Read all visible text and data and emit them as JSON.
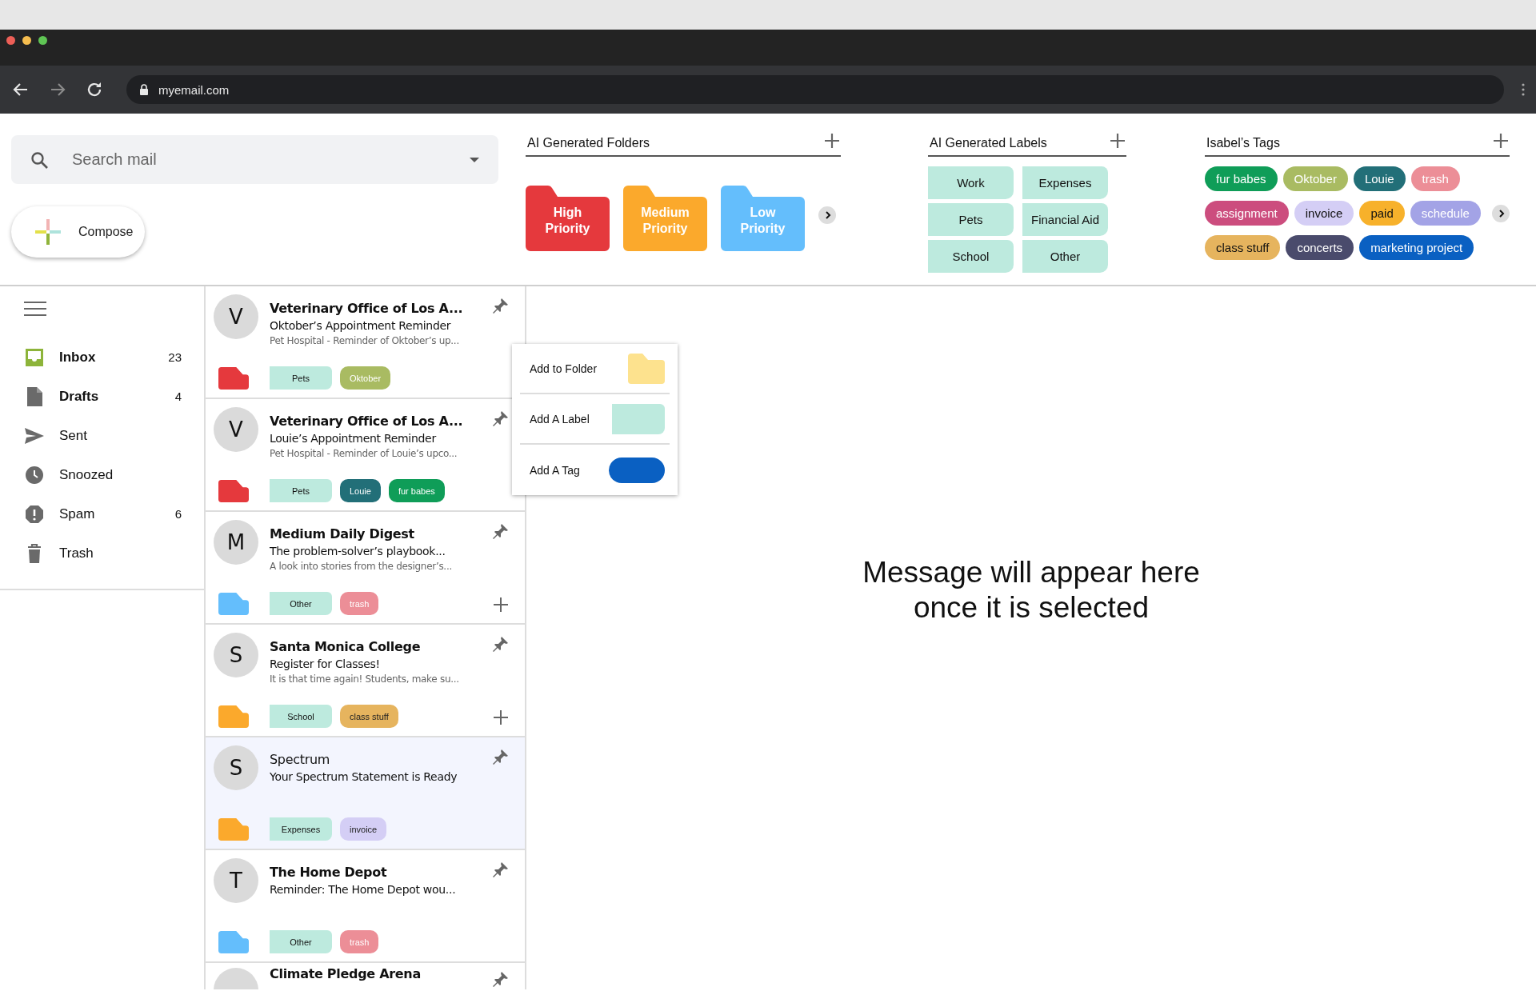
{
  "browser": {
    "url": "myemail.com"
  },
  "search": {
    "placeholder": "Search mail"
  },
  "compose": {
    "label": "Compose"
  },
  "folders_section": {
    "title": "AI Generated Folders",
    "folders": [
      {
        "label": "High Priority",
        "color": "#e5393d"
      },
      {
        "label": "Medium Priority",
        "color": "#fba92c"
      },
      {
        "label": "Low Priority",
        "color": "#64befc"
      }
    ]
  },
  "labels_section": {
    "title": "AI Generated Labels",
    "labels": [
      "Work",
      "Expenses",
      "Pets",
      "Financial Aid",
      "School",
      "Other"
    ]
  },
  "tags_section": {
    "title": "Isabel’s Tags",
    "tags": [
      {
        "label": "fur babes",
        "color": "#0f9d58"
      },
      {
        "label": "Oktober",
        "color": "#a9bb62"
      },
      {
        "label": "Louie",
        "color": "#226f78"
      },
      {
        "label": "trash",
        "color": "#ec8e97"
      },
      {
        "label": "assignment",
        "color": "#cc4d7e"
      },
      {
        "label": "invoice",
        "color": "#d4cef5"
      },
      {
        "label": "paid",
        "color": "#f7b12b"
      },
      {
        "label": "schedule",
        "color": "#a3a3e6"
      },
      {
        "label": "class stuff",
        "color": "#e6b45e"
      },
      {
        "label": "concerts",
        "color": "#4a4b6c"
      },
      {
        "label": "marketing project",
        "color": "#0a60c2"
      }
    ]
  },
  "sidebar": {
    "items": [
      {
        "kind": "inbox",
        "label": "Inbox",
        "count": "23",
        "selected": true,
        "unread": true
      },
      {
        "kind": "drafts",
        "label": "Drafts",
        "count": "4",
        "selected": false,
        "unread": true
      },
      {
        "kind": "sent",
        "label": "Sent",
        "selected": false,
        "unread": false
      },
      {
        "kind": "snoozed",
        "label": "Snoozed",
        "selected": false,
        "unread": false
      },
      {
        "kind": "spam",
        "label": "Spam",
        "count": "6",
        "selected": false,
        "unread": false
      },
      {
        "kind": "trash",
        "label": "Trash",
        "selected": false,
        "unread": false
      }
    ]
  },
  "emails": [
    {
      "avatar": "V",
      "sender": "Veterinary Office of Los A...",
      "subject": "Oktober’s Appointment Reminder",
      "snippet": "Pet Hospital - Reminder of Oktober’s up...",
      "unread": true,
      "selected": false,
      "add_button": false,
      "folder": {
        "color": "#e5393d"
      },
      "chips": [
        {
          "kind": "label",
          "text": "Pets"
        },
        {
          "kind": "tag",
          "text": "Oktober",
          "color": "#a9bb62"
        }
      ]
    },
    {
      "avatar": "V",
      "sender": "Veterinary Office of Los A...",
      "subject": "Louie’s Appointment Reminder",
      "snippet": "Pet Hospital - Reminder of Louie’s upco...",
      "unread": true,
      "selected": false,
      "add_button": false,
      "folder": {
        "color": "#e5393d"
      },
      "chips": [
        {
          "kind": "label",
          "text": "Pets"
        },
        {
          "kind": "tag",
          "text": "Louie",
          "color": "#226f78"
        },
        {
          "kind": "tag",
          "text": "fur babes",
          "color": "#0f9d58"
        }
      ]
    },
    {
      "avatar": "M",
      "sender": "Medium Daily Digest",
      "subject": "The problem-solver’s playbook...",
      "snippet": "A look into stories from the designer’s...",
      "unread": true,
      "selected": false,
      "add_button": true,
      "folder": {
        "color": "#64befc"
      },
      "chips": [
        {
          "kind": "label",
          "text": "Other"
        },
        {
          "kind": "tag",
          "text": "trash",
          "color": "#ec8e97"
        }
      ]
    },
    {
      "avatar": "S",
      "sender": "Santa Monica College",
      "subject": "Register for Classes!",
      "snippet": "It is that time again! Students, make su...",
      "unread": true,
      "selected": false,
      "add_button": true,
      "folder": {
        "color": "#fba92c"
      },
      "chips": [
        {
          "kind": "label",
          "text": "School"
        },
        {
          "kind": "tag",
          "text": "class stuff",
          "color": "#e6b45e"
        }
      ]
    },
    {
      "avatar": "S",
      "sender": "Spectrum",
      "subject": "Your Spectrum Statement is Ready",
      "unread": false,
      "selected": true,
      "add_button": false,
      "folder": {
        "color": "#fba92c"
      },
      "chips": [
        {
          "kind": "label",
          "text": "Expenses"
        },
        {
          "kind": "tag",
          "text": "invoice",
          "color": "#d4cef5"
        }
      ]
    },
    {
      "avatar": "T",
      "sender": "The Home Depot",
      "subject": "Reminder: The Home Depot wou...",
      "unread": true,
      "selected": false,
      "add_button": false,
      "folder": {
        "color": "#64befc"
      },
      "chips": [
        {
          "kind": "label",
          "text": "Other"
        },
        {
          "kind": "tag",
          "text": "trash",
          "color": "#ec8e97"
        }
      ]
    },
    {
      "sender": "Climate Pledge Arena",
      "unread": true,
      "selected": false,
      "add_button": false
    }
  ],
  "menu": {
    "items": [
      {
        "kind": "folder",
        "label": "Add to Folder"
      },
      {
        "kind": "label",
        "label": "Add A Label"
      },
      {
        "kind": "tag",
        "label": "Add A Tag"
      }
    ]
  },
  "message_placeholder": "Message will appear here once it is selected"
}
